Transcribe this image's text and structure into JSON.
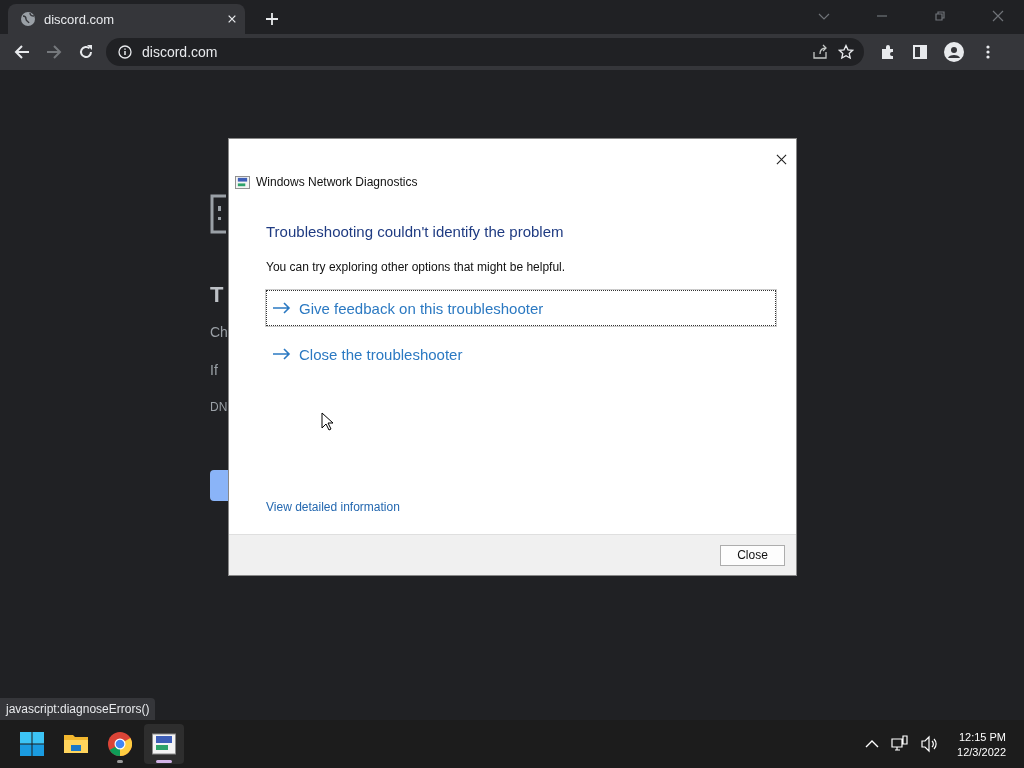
{
  "browser": {
    "tab": {
      "title": "discord.com"
    },
    "address": "discord.com"
  },
  "page": {
    "heading": "T",
    "lines": [
      "Ch",
      "If",
      "DN"
    ]
  },
  "status_link": "javascript:diagnoseErrors()",
  "dialog": {
    "app_title": "Windows Network Diagnostics",
    "heading": "Troubleshooting couldn't identify the problem",
    "message": "You can try exploring other options that might be helpful.",
    "options": [
      {
        "label": "Give feedback on this troubleshooter",
        "focused": true
      },
      {
        "label": "Close the troubleshooter",
        "focused": false
      }
    ],
    "details_link": "View detailed information",
    "buttons": [
      "Close"
    ]
  },
  "taskbar": {
    "apps": [
      {
        "kind": "start",
        "running": false,
        "selected": false
      },
      {
        "kind": "folder",
        "running": false,
        "selected": false
      },
      {
        "kind": "browser",
        "running": true,
        "selected": false
      },
      {
        "kind": "diagnostics",
        "running": true,
        "selected": true
      }
    ],
    "clock": {
      "time": "12:15 PM",
      "date": "12/3/2022"
    }
  }
}
